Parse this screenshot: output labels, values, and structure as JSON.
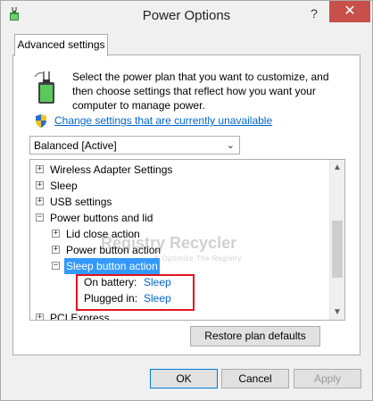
{
  "window": {
    "title": "Power Options",
    "help_label": "?",
    "close_label": "✕"
  },
  "tab": {
    "label": "Advanced settings"
  },
  "description": "Select the power plan that you want to customize, and then choose settings that reflect how you want your computer to manage power.",
  "change_link": "Change settings that are currently unavailable",
  "plan_select": {
    "value": "Balanced [Active]"
  },
  "tree": {
    "rows": [
      {
        "label": "Wireless Adapter Settings",
        "expander": "+"
      },
      {
        "label": "Sleep",
        "expander": "+"
      },
      {
        "label": "USB settings",
        "expander": "+"
      },
      {
        "label": "Power buttons and lid",
        "expander": "−"
      },
      {
        "label": "Lid close action",
        "expander": "+"
      },
      {
        "label": "Power button action",
        "expander": "+"
      },
      {
        "label": "Sleep button action",
        "expander": "−"
      },
      {
        "label": "On battery:",
        "value": "Sleep"
      },
      {
        "label": "Plugged in:",
        "value": "Sleep"
      },
      {
        "label": "PCI Express",
        "expander": "+"
      }
    ]
  },
  "watermark": {
    "text": "Registry Recycler",
    "subtext": "& Optimize The Registry"
  },
  "buttons": {
    "restore": "Restore plan defaults",
    "ok": "OK",
    "cancel": "Cancel",
    "apply": "Apply"
  },
  "colors": {
    "selection": "#3399ff",
    "link": "#0066cc",
    "close": "#c7504a",
    "highlight_box": "#e1141d"
  },
  "icons": {
    "app": "power-options-icon",
    "battery": "battery-plug-icon",
    "shield": "uac-shield-icon"
  }
}
